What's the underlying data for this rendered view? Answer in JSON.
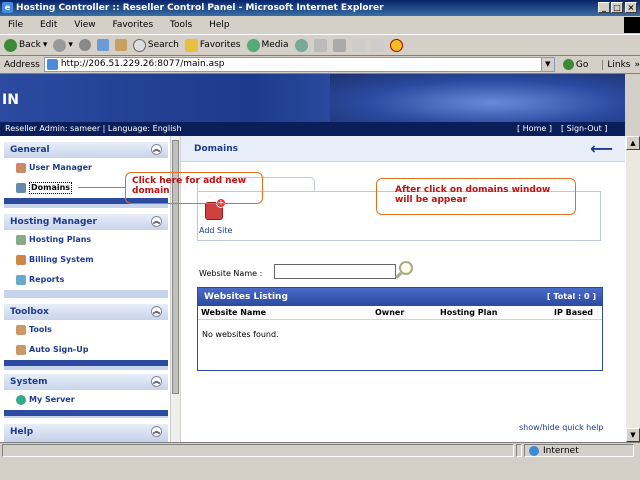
{
  "window": {
    "title": "Hosting Controller :: Reseller Control Panel - Microsoft Internet Explorer"
  },
  "menu": [
    "File",
    "Edit",
    "View",
    "Favorites",
    "Tools",
    "Help"
  ],
  "toolbar": {
    "back": "Back",
    "search": "Search",
    "favorites": "Favorites",
    "media": "Media"
  },
  "address": {
    "label": "Address",
    "url": "http://206.51.229.26:8077/main.asp",
    "go": "Go",
    "links": "Links"
  },
  "banner": {
    "title_fragment": "IN"
  },
  "infobar": {
    "left": "Reseller Admin: sameer | Language: English",
    "home": "[ Home ]",
    "signout": "[ Sign-Out ]"
  },
  "sidebar": {
    "general": {
      "title": "General",
      "items": [
        "User Manager",
        "Domains"
      ]
    },
    "hosting": {
      "title": "Hosting Manager",
      "items": [
        "Hosting Plans",
        "Billing System",
        "Reports"
      ]
    },
    "toolbox": {
      "title": "Toolbox",
      "items": [
        "Tools",
        "Auto Sign-Up"
      ]
    },
    "system": {
      "title": "System",
      "items": [
        "My Server"
      ]
    },
    "help": {
      "title": "Help"
    }
  },
  "main": {
    "title": "Domains",
    "add_site": "Add Site",
    "search_label": "Website Name :",
    "search_value": "",
    "listing_title": "Websites Listing",
    "listing_total": "[ Total : 0 ]",
    "columns": [
      "Website Name",
      "Owner",
      "Hosting Plan",
      "IP Based"
    ],
    "empty": "No websites found.",
    "quick_help": "show/hide quick help"
  },
  "annotations": {
    "left": "Click here for add new domain",
    "right": "After click on domains window will be appear"
  },
  "status": {
    "zone": "Internet"
  },
  "colors": {
    "accent": "#1e3a8a",
    "banner": "#2b4aa0",
    "callout_text": "#c01010",
    "callout_border": "#e07020"
  }
}
